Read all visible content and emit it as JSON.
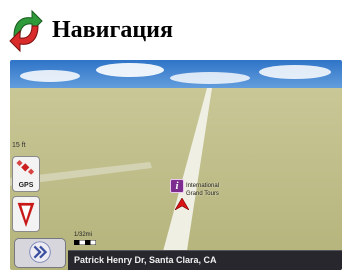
{
  "header": {
    "title": "Навигация",
    "logo_icon": "navigation-arrows-logo"
  },
  "map": {
    "speed_readout": "15 ft",
    "gps_button": {
      "label": "GPS",
      "icon": "satellite-icon"
    },
    "compass_button": {
      "label": "N",
      "icon": "compass-icon"
    },
    "poi": {
      "glyph": "i",
      "label_line1": "International",
      "label_line2": "Grand Tours"
    },
    "scale_label": "1/32mi",
    "expand_button_icon": "double-chevron-right-icon",
    "street_name": "Patrick Henry Dr, Santa Clara, CA"
  },
  "colors": {
    "sky": "#3b7fcf",
    "ground": "#bdbc86",
    "road": "#eeeee2",
    "poi": "#7c2d8e",
    "street_bar": "#27272d",
    "arrow": "#d81414"
  }
}
